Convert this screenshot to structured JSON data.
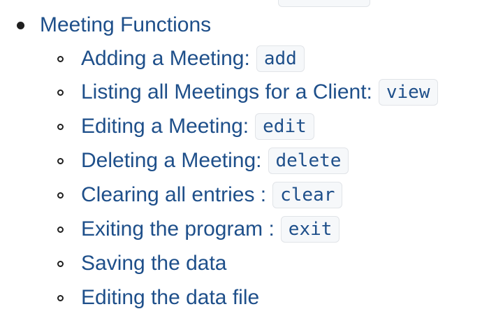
{
  "section": {
    "title": "Meeting Functions",
    "items": [
      {
        "label": "Adding a Meeting:",
        "command": "add"
      },
      {
        "label": "Listing all Meetings for a Client:",
        "command": "view"
      },
      {
        "label": "Editing a Meeting:",
        "command": "edit"
      },
      {
        "label": "Deleting a Meeting:",
        "command": "delete"
      },
      {
        "label": "Clearing all entries :",
        "command": "clear"
      },
      {
        "label": "Exiting the program :",
        "command": "exit"
      },
      {
        "label": "Saving the data",
        "command": null
      },
      {
        "label": "Editing the data file",
        "command": null
      }
    ]
  }
}
